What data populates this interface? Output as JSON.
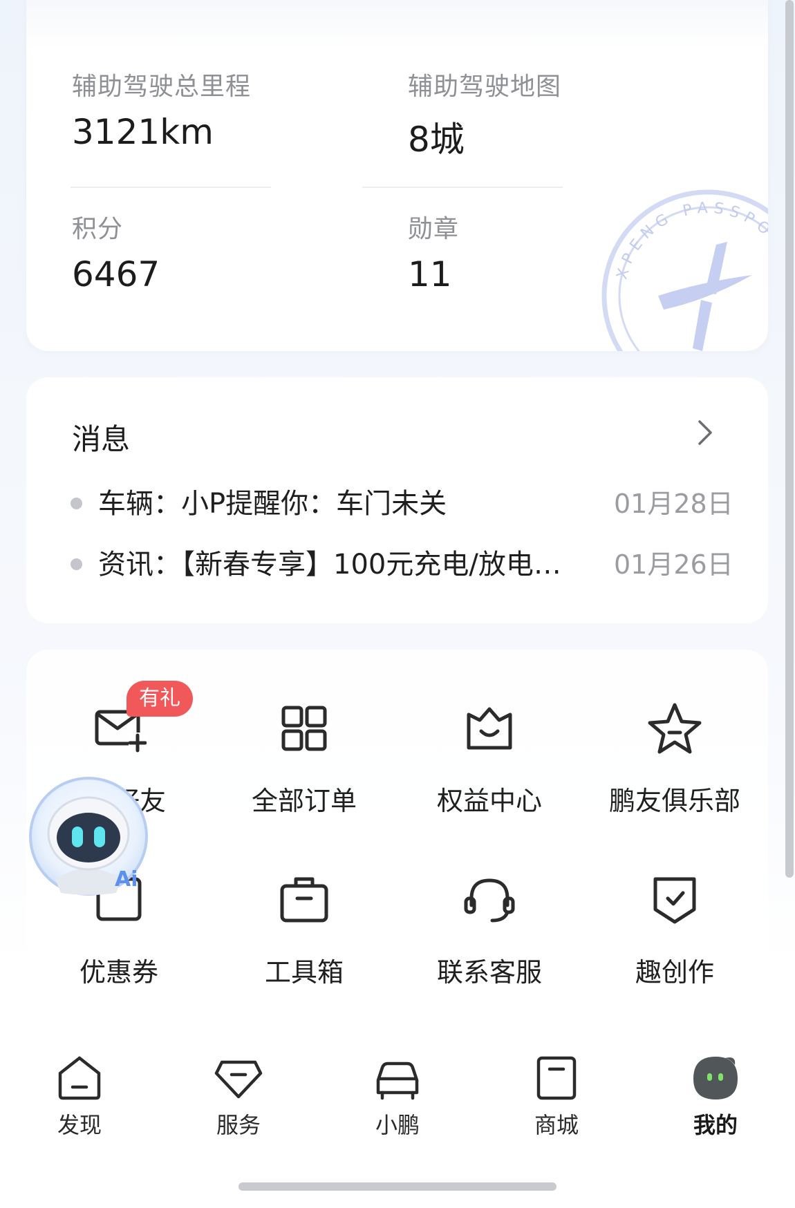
{
  "stats": {
    "assist_mileage": {
      "label": "辅助驾驶总里程",
      "value": "3121km"
    },
    "assist_map": {
      "label": "辅助驾驶地图",
      "value": "8城"
    },
    "points": {
      "label": "积分",
      "value": "6467"
    },
    "medals": {
      "label": "勋章",
      "value": "11"
    },
    "stamp_text": "XPENG PASSPORT"
  },
  "messages": {
    "title": "消息",
    "items": [
      {
        "text": "车辆：小P提醒你：车门未关",
        "date": "01月28日"
      },
      {
        "text": "资讯：【新春专享】100元充电/放电…",
        "date": "01月26日"
      }
    ]
  },
  "menu": {
    "badge": "有礼",
    "items": [
      {
        "label": "好友",
        "icon": "mail-plus-icon"
      },
      {
        "label": "全部订单",
        "icon": "grid-icon"
      },
      {
        "label": "权益中心",
        "icon": "crown-box-icon"
      },
      {
        "label": "鹏友俱乐部",
        "icon": "star-icon"
      },
      {
        "label": "优惠券",
        "icon": "coupon-icon"
      },
      {
        "label": "工具箱",
        "icon": "toolbox-icon"
      },
      {
        "label": "联系客服",
        "icon": "headset-icon"
      },
      {
        "label": "趣创作",
        "icon": "shield-check-icon"
      }
    ]
  },
  "ai_assistant": {
    "badge": "Ai"
  },
  "tabbar": {
    "items": [
      {
        "label": "发现",
        "icon": "home-icon"
      },
      {
        "label": "服务",
        "icon": "diamond-icon"
      },
      {
        "label": "小鹏",
        "icon": "car-icon"
      },
      {
        "label": "商城",
        "icon": "shop-icon"
      },
      {
        "label": "我的",
        "icon": "avatar-icon",
        "active": true
      }
    ]
  },
  "colors": {
    "accent": "#f0585a",
    "stamp": "#c9d2f2",
    "text_primary": "#1f1f1f",
    "text_secondary": "#8e9096"
  }
}
